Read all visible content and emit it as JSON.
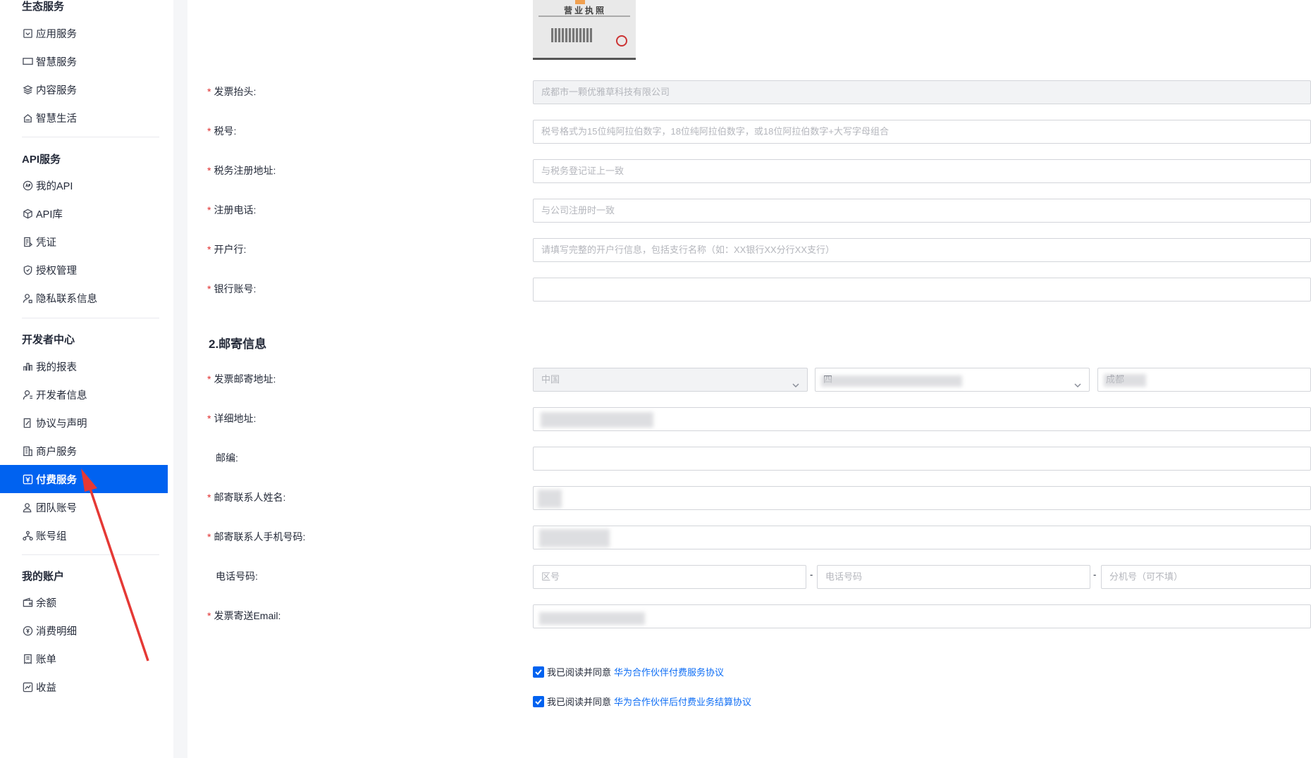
{
  "sidebar": {
    "groups": [
      {
        "title": "生态服务",
        "items": [
          {
            "label": "应用服务",
            "icon": "app-icon"
          },
          {
            "label": "智慧服务",
            "icon": "screen-icon"
          },
          {
            "label": "内容服务",
            "icon": "layers-icon"
          },
          {
            "label": "智慧生活",
            "icon": "home-icon"
          }
        ]
      },
      {
        "title": "API服务",
        "items": [
          {
            "label": "我的API",
            "icon": "api-icon"
          },
          {
            "label": "API库",
            "icon": "cube-icon"
          },
          {
            "label": "凭证",
            "icon": "document-icon"
          },
          {
            "label": "授权管理",
            "icon": "shield-icon"
          },
          {
            "label": "隐私联系信息",
            "icon": "user-lock-icon"
          }
        ]
      },
      {
        "title": "开发者中心",
        "items": [
          {
            "label": "我的报表",
            "icon": "bar-chart-icon"
          },
          {
            "label": "开发者信息",
            "icon": "user-icon"
          },
          {
            "label": "协议与声明",
            "icon": "agreement-icon"
          },
          {
            "label": "商户服务",
            "icon": "building-icon"
          },
          {
            "label": "付费服务",
            "icon": "payment-icon",
            "active": true
          },
          {
            "label": "团队账号",
            "icon": "team-icon"
          },
          {
            "label": "账号组",
            "icon": "group-icon"
          }
        ]
      },
      {
        "title": "我的账户",
        "items": [
          {
            "label": "余额",
            "icon": "wallet-icon"
          },
          {
            "label": "消费明细",
            "icon": "coin-icon"
          },
          {
            "label": "账单",
            "icon": "bill-icon"
          },
          {
            "label": "收益",
            "icon": "trend-icon"
          }
        ]
      }
    ]
  },
  "license": {
    "title": "营业执照"
  },
  "invoice": {
    "title_label": "发票抬头:",
    "title_value": "成都市一颗优雅草科技有限公司",
    "tax_label": "税号:",
    "tax_placeholder": "税号格式为15位纯阿拉伯数字，18位纯阿拉伯数字，或18位阿拉伯数字+大写字母组合",
    "tax_address_label": "税务注册地址:",
    "tax_address_placeholder": "与税务登记证上一致",
    "phone_label": "注册电话:",
    "phone_placeholder": "与公司注册时一致",
    "bank_label": "开户行:",
    "bank_placeholder": "请填写完整的开户行信息，包括支行名称（如：XX银行XX分行XX支行）",
    "account_label": "银行账号:",
    "account_value": ""
  },
  "mailing": {
    "section_title": "2.邮寄信息",
    "address_label": "发票邮寄地址:",
    "country_value": "中国",
    "province_value": "四",
    "city_value": "成都",
    "detail_label": "详细地址:",
    "postcode_label": "邮编:",
    "contact_name_label": "邮寄联系人姓名:",
    "contact_phone_label": "邮寄联系人手机号码:",
    "tel_label": "电话号码:",
    "area_placeholder": "区号",
    "tel_placeholder": "电话号码",
    "ext_placeholder": "分机号（可不填）",
    "dash": "-",
    "email_label": "发票寄送Email:"
  },
  "agreements": [
    {
      "prefix": "我已阅读并同意",
      "link": "华为合作伙伴付费服务协议",
      "checked": true
    },
    {
      "prefix": "我已阅读并同意",
      "link": "华为合作伙伴后付费业务结算协议",
      "checked": true
    }
  ],
  "colors": {
    "accent": "#0062f0",
    "required": "#e02e2e",
    "link": "#0d6df5",
    "annotation_arrow": "#e53935"
  }
}
